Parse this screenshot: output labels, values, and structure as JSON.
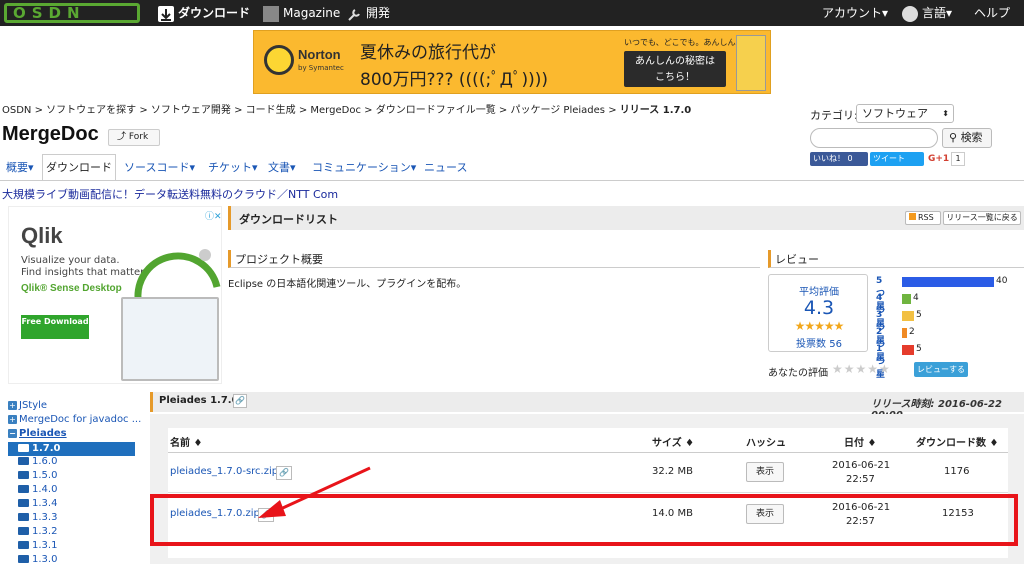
{
  "topbar": {
    "logo": "OSDN",
    "download": "ダウンロード",
    "magazine": "Magazine",
    "develop": "開発",
    "account": "アカウント▾",
    "language": "言語▾",
    "help": "ヘルプ"
  },
  "banner": {
    "brand": "Norton",
    "brand_sub": "by Symantec",
    "line1": "夏休みの旅行代が",
    "line2": "800万円??? ((((;ﾟДﾟ))))",
    "small": "いつでも、どこでも。あんしん。",
    "cta_line1": "あんしんの秘密は",
    "cta_line2": "こちら！"
  },
  "breadcrumb": {
    "items": [
      "OSDN",
      "ソフトウェアを探す",
      "ソフトウェア開発",
      "コード生成",
      "MergeDoc",
      "ダウンロードファイル一覧",
      "パッケージ Pleiades"
    ],
    "current": "リリース 1.7.0",
    "sep": " > "
  },
  "project": {
    "title": "MergeDoc",
    "fork": "Fork"
  },
  "sidebar_right": {
    "category_label": "カテゴリ:",
    "category_value": "ソフトウェア",
    "search_button": "検索",
    "fb_like": "いいね！ 0",
    "tweet": "ツイート",
    "gplus": "G+1",
    "gplus_count": "1"
  },
  "tabs": {
    "overview": "概要▾",
    "download": "ダウンロード",
    "source": "ソースコード▾",
    "ticket": "チケット▾",
    "docs": "文書▾",
    "community": "コミュニケーション▾",
    "news": "ニュース"
  },
  "ad_link": "大規模ライブ動画配信に！データ転送料無料のクラウド／NTT Com",
  "qlik_ad": {
    "logo": "Qlik",
    "line1": "Visualize your data.",
    "line2": "Find insights that matter.",
    "line3": "Qlik® Sense Desktop",
    "button": "Free Download"
  },
  "download_list": {
    "title": "ダウンロードリスト",
    "rss": "RSS",
    "release_list": "リリース一覧に戻る"
  },
  "project_overview": {
    "title": "プロジェクト概要",
    "description": "Eclipse の日本語化関連ツール、プラグインを配布。"
  },
  "review": {
    "title": "レビュー",
    "avg_label": "平均評価",
    "avg": "4.3",
    "stars": "★★★★★",
    "count_label": "投票数 56",
    "your_rating": "あなたの評価",
    "your_stars": "★★★★★",
    "review_button": "レビューする",
    "rows": [
      {
        "label": "5つ星",
        "count": 40,
        "color": "#2b5ce6"
      },
      {
        "label": "4つ星",
        "count": 4,
        "color": "#6fb43f"
      },
      {
        "label": "3つ星",
        "count": 5,
        "color": "#f2c043"
      },
      {
        "label": "2つ星",
        "count": 2,
        "color": "#f08a24"
      },
      {
        "label": "1つ星",
        "count": 5,
        "color": "#e53c2c"
      }
    ]
  },
  "tree": {
    "items": [
      "JStyle",
      "MergeDoc for javadoc ...",
      "Pleiades"
    ],
    "active": "1.7.0",
    "versions": [
      "1.6.0",
      "1.5.0",
      "1.4.0",
      "1.3.4",
      "1.3.3",
      "1.3.2",
      "1.3.1",
      "1.3.0"
    ]
  },
  "release": {
    "title": "Pleiades 1.7.0",
    "date": "リリース時刻: 2016-06-22 00:00",
    "columns": {
      "name": "名前 ♦",
      "size": "サイズ ♦",
      "hash": "ハッシュ",
      "date": "日付 ♦",
      "downloads": "ダウンロード数 ♦"
    },
    "files": [
      {
        "name": "pleiades_1.7.0-src.zip",
        "size": "32.2 MB",
        "hash": "表示",
        "date1": "2016-06-21",
        "date2": "22:57",
        "downloads": "1176"
      },
      {
        "name": "pleiades_1.7.0.zip",
        "size": "14.0 MB",
        "hash": "表示",
        "date1": "2016-06-21",
        "date2": "22:57",
        "downloads": "12153"
      }
    ]
  }
}
